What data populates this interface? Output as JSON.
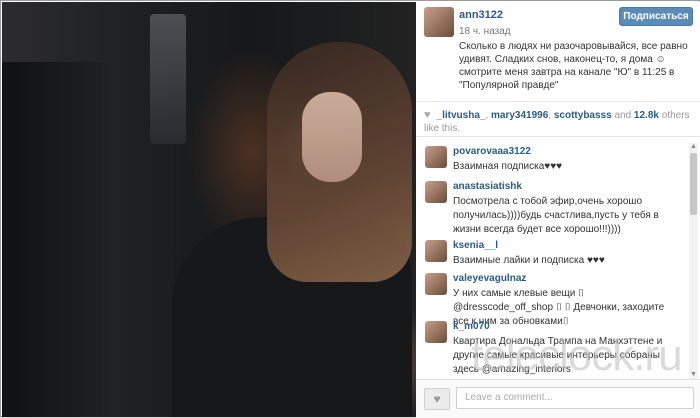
{
  "post": {
    "username": "ann3122",
    "follow_label": "Подписаться",
    "time_ago": "18 ч. назад",
    "caption": "Сколько в людях ни разочаровывайся, все равно удивят. Сладких снов, наконец-то, я дома ☺ смотрите меня завтра на канале \"Ю\" в 11:25 в \"Популярной правде\""
  },
  "likes": {
    "users": [
      "_litvusha_",
      "mary341996",
      "scottybasss"
    ],
    "more": "12.8k",
    "tail": "others like this."
  },
  "comments": [
    {
      "user": "povarovaaa3122",
      "text": "Взаимная подписка♥♥♥"
    },
    {
      "user": "anastasiatishk",
      "text": "Посмотрела с тобой эфир,очень хорошо получилась))))будь счастлива,пусть у тебя в жизни всегда будет все хорошо!!!))))"
    },
    {
      "user": "ksenia__l",
      "text": "Взаимные лайки и подписка ♥♥♥"
    },
    {
      "user": "valeyevagulnaz",
      "text": "У них самые клевые вещи ⌷ @dresscode_off_shop ⌷ ⌷ Девчонки, заходите все к ним за обновками⌷"
    },
    {
      "user": "k_m070",
      "text": "Квартира Дональда Трампа на Манхэттене и другие самые красивые интерьеры собраны здесь @amazing_interiors"
    }
  ],
  "footer": {
    "placeholder": "Leave a comment..."
  },
  "watermark": "teleclock.ru",
  "colors": {
    "link": "#2b5b84",
    "button": "#5c8bb8"
  }
}
